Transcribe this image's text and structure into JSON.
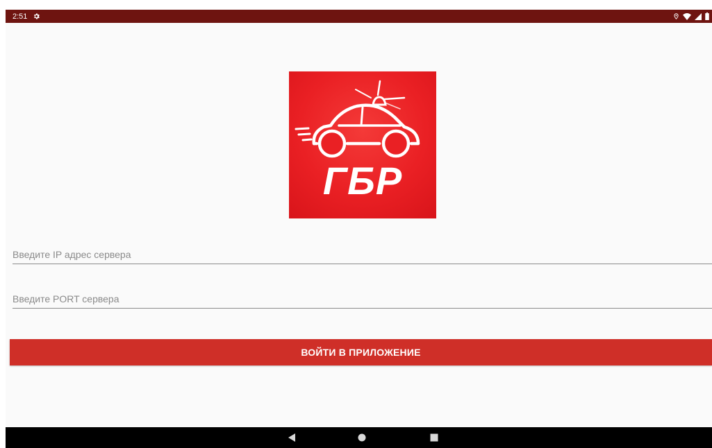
{
  "status_bar": {
    "time": "2:51",
    "icons": [
      "settings-icon",
      "location-icon",
      "wifi-icon",
      "signal-icon",
      "battery-icon"
    ]
  },
  "logo": {
    "text": "ГБР",
    "icon": "police-car-icon",
    "background_color": "#ea2024"
  },
  "form": {
    "ip_field": {
      "placeholder": "Введите IP адрес сервера",
      "value": ""
    },
    "port_field": {
      "placeholder": "Введите PORT сервера",
      "value": ""
    },
    "login_button_label": "ВОЙТИ В ПРИЛОЖЕНИЕ"
  },
  "nav_bar": {
    "buttons": [
      "back-icon",
      "home-icon",
      "recents-icon"
    ]
  },
  "colors": {
    "status_bar": "#6e1410",
    "accent": "#cf2f28",
    "background": "#fafafa"
  }
}
